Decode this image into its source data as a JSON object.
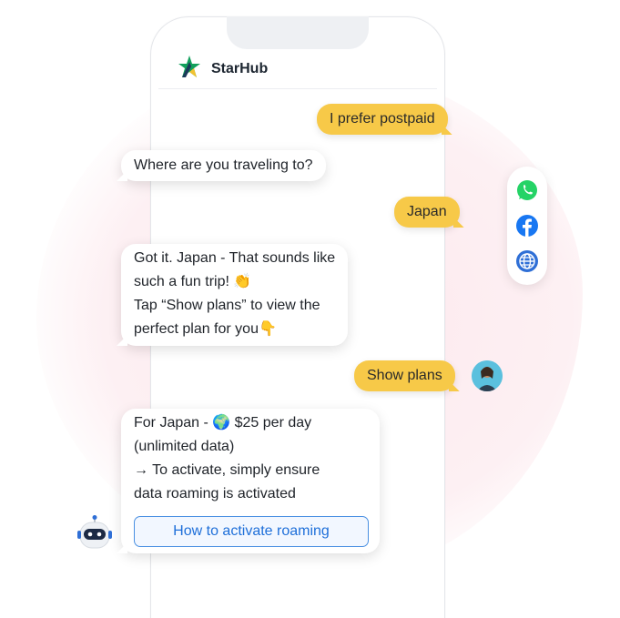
{
  "brand": {
    "name": "StarHub"
  },
  "messages": {
    "m1": "I prefer postpaid",
    "m2": "Where are you traveling to?",
    "m3": "Japan",
    "m4_line1": "Got it. Japan - That sounds like",
    "m4_line2": "such a fun trip! 👏",
    "m4_line3": "Tap “Show plans” to view the",
    "m4_line4": "perfect plan for you👇",
    "m5": "Show plans",
    "m6_line1": "For Japan - 🌍 $25 per day",
    "m6_line2": "(unlimited data)",
    "m6_line3": "→ To activate, simply ensure",
    "m6_line4": "data roaming is activated",
    "cta": "How to activate roaming"
  },
  "channels": [
    "whatsapp-icon",
    "facebook-icon",
    "globe-icon"
  ],
  "colors": {
    "user_bubble": "#f7c948",
    "cta": "#1e6fd9",
    "brand_green": "#12a05c",
    "brand_navy": "#1c3a5a"
  }
}
